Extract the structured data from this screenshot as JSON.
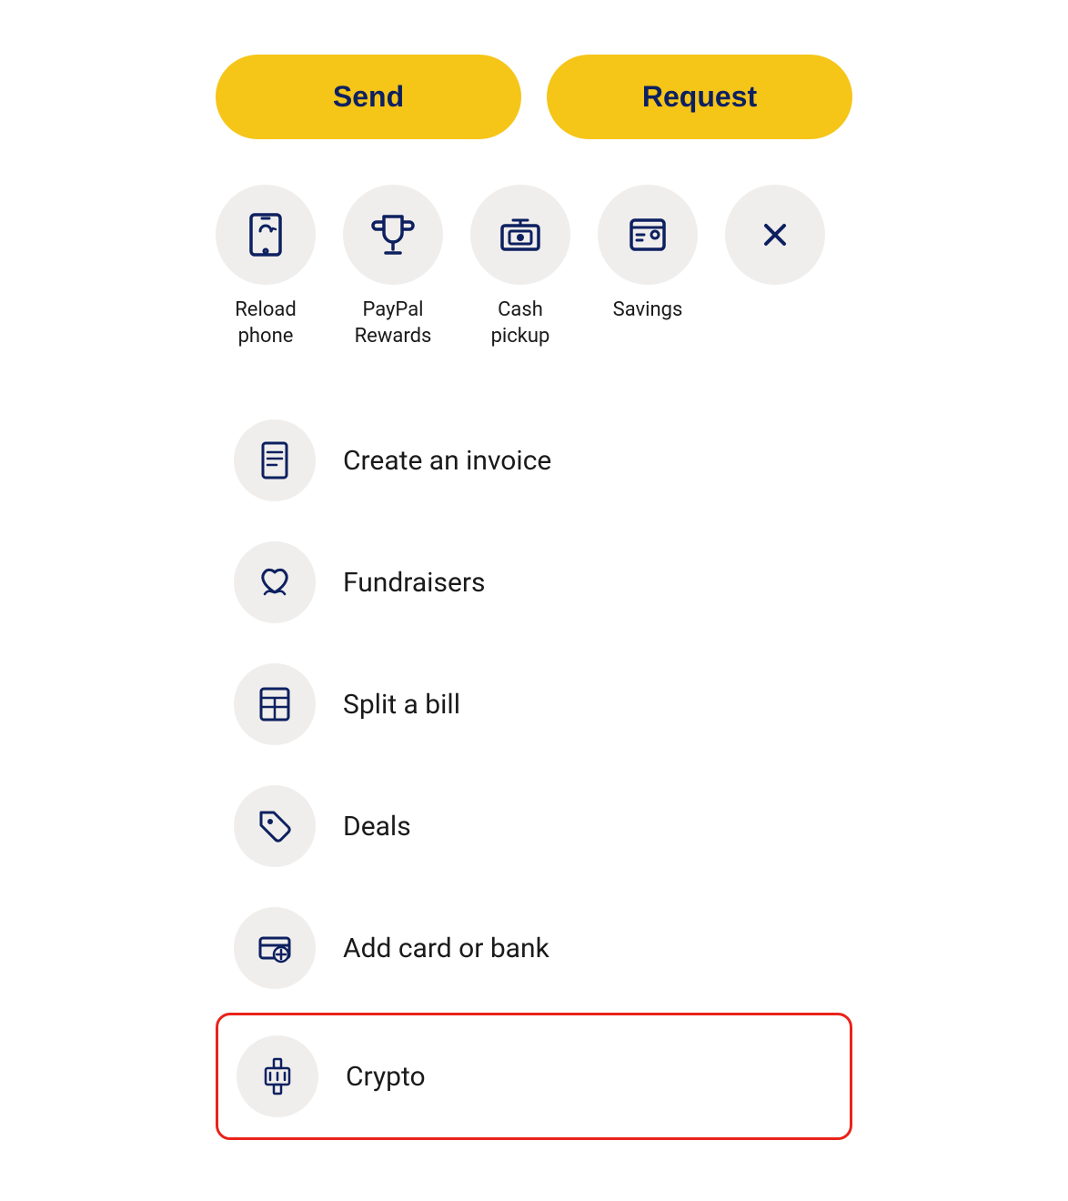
{
  "buttons": {
    "send_label": "Send",
    "request_label": "Request"
  },
  "quick_actions": [
    {
      "id": "reload-phone",
      "label": "Reload\nphone",
      "icon": "reload-phone-icon"
    },
    {
      "id": "paypal-rewards",
      "label": "PayPal\nRewards",
      "icon": "trophy-icon"
    },
    {
      "id": "cash-pickup",
      "label": "Cash\npickup",
      "icon": "cash-pickup-icon"
    },
    {
      "id": "savings",
      "label": "Savings",
      "icon": "savings-icon"
    },
    {
      "id": "close",
      "label": "",
      "icon": "close-icon"
    }
  ],
  "list_items": [
    {
      "id": "create-invoice",
      "label": "Create an invoice",
      "icon": "invoice-icon"
    },
    {
      "id": "fundraisers",
      "label": "Fundraisers",
      "icon": "fundraisers-icon"
    },
    {
      "id": "split-bill",
      "label": "Split a bill",
      "icon": "split-bill-icon"
    },
    {
      "id": "deals",
      "label": "Deals",
      "icon": "deals-icon"
    },
    {
      "id": "add-card-bank",
      "label": "Add card or bank",
      "icon": "add-card-bank-icon"
    },
    {
      "id": "crypto",
      "label": "Crypto",
      "icon": "crypto-icon"
    }
  ],
  "colors": {
    "accent": "#F5C518",
    "primary_text": "#0d2060",
    "icon_bg": "#f0eeec",
    "highlight_border": "#e8231a"
  }
}
